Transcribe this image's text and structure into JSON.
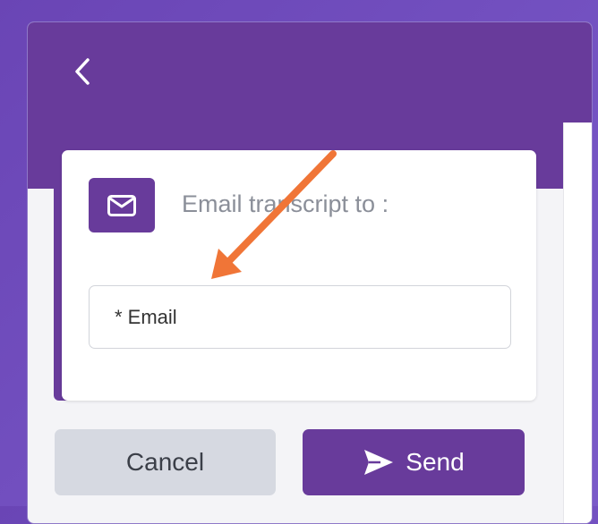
{
  "header": {
    "back_icon": "chevron-left-icon"
  },
  "card": {
    "icon": "envelope-icon",
    "title": "Email transcript to :",
    "email_field": {
      "label": "* Email",
      "value": ""
    }
  },
  "actions": {
    "cancel_label": "Cancel",
    "send_label": "Send",
    "send_icon": "paper-plane-icon"
  },
  "annotation": {
    "arrow_color": "#f07537"
  },
  "colors": {
    "accent": "#683b9b",
    "background": "#7452c2"
  }
}
